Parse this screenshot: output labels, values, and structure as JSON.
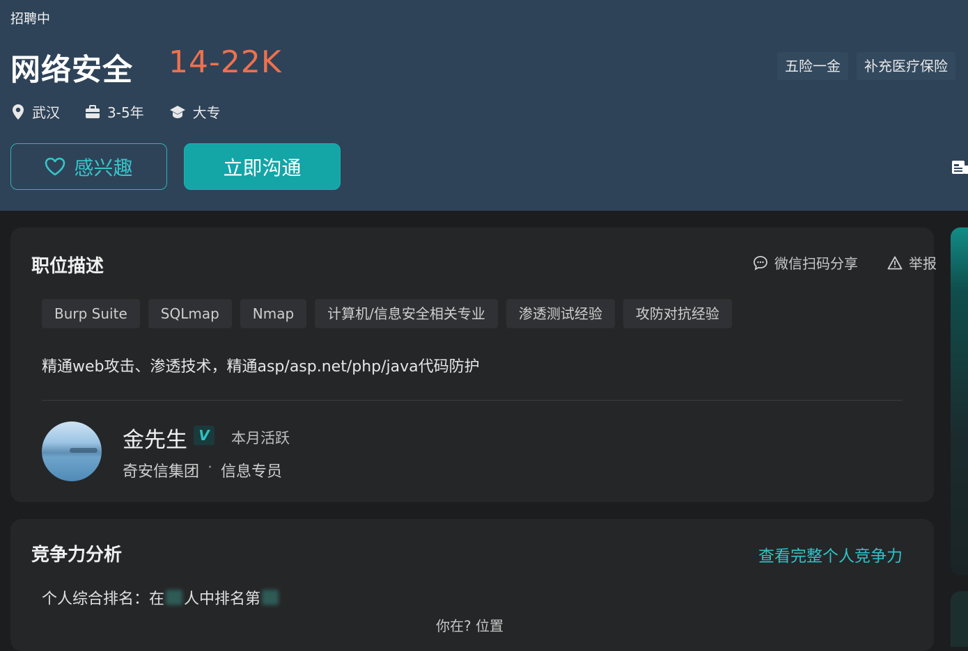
{
  "header": {
    "status": "招聘中",
    "title": "网络安全",
    "salary": "14-22K",
    "benefits": [
      "五险一金",
      "补充医疗保险"
    ],
    "meta": {
      "location": "武汉",
      "experience": "3-5年",
      "education": "大专"
    },
    "buttons": {
      "interest": "感兴趣",
      "chat": "立即沟通"
    }
  },
  "description": {
    "title": "职位描述",
    "share": "微信扫码分享",
    "report": "举报",
    "tags": [
      "Burp Suite",
      "SQLmap",
      "Nmap",
      "计算机/信息安全相关专业",
      "渗透测试经验",
      "攻防对抗经验"
    ],
    "text": "精通web攻击、渗透技术，精通asp/asp.net/php/java代码防护",
    "recruiter": {
      "name": "金先生",
      "verified_badge": "V",
      "activity": "本月活跃",
      "company": "奇安信集团",
      "separator": "·",
      "role": "信息专员"
    }
  },
  "competitiveness": {
    "title": "竞争力分析",
    "view_full": "查看完整个人竞争力",
    "rank_prefix": "个人综合排名：在",
    "rank_middle": "人中排名第",
    "position_text": "你在? 位置"
  },
  "colors": {
    "header_bg": "#2e4358",
    "page_bg": "#1c1d1f",
    "accent": "#14a5a6",
    "salary": "#f0704d"
  }
}
